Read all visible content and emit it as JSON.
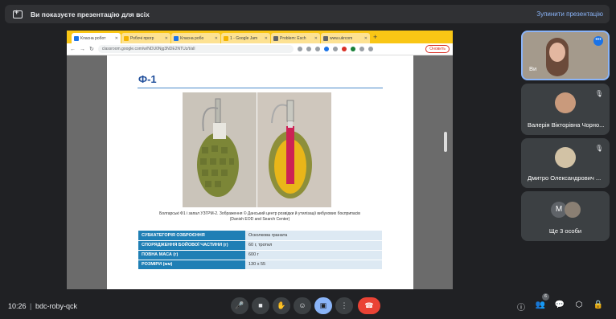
{
  "banner": {
    "text": "Ви показуєте презентацію для всіх",
    "stop_label": "Зупинити презентацію"
  },
  "browser": {
    "tabs": [
      {
        "label": "Класна робот"
      },
      {
        "label": "Робочі прогр"
      },
      {
        "label": "Класна робо"
      },
      {
        "label": "1 - Google Jam"
      },
      {
        "label": "Problem: Esch"
      },
      {
        "label": "www.ukrcom"
      }
    ],
    "new_tab": "+",
    "url": "classroom.google.com/w/NDU0Njg3NDE2NTUz/t/all",
    "reload_label": "Оновить"
  },
  "document": {
    "heading": "Ф-1",
    "caption_line1": "Болгарські Ф1 і запал УЗГРМ-2. Зображення © Данський центр розвідки й утилізації вибухових боєприпасів",
    "caption_line2": "(Danish EOD and Search Center)",
    "rows": [
      {
        "key": "СУБКАТЕГОРІЯ ОЗБРОЄННЯ",
        "value": "Осколкова граната"
      },
      {
        "key": "СПОРЯДЖЕННЯ БОЙОВОЇ ЧАСТИНИ (г)",
        "value": "60 г, тротил"
      },
      {
        "key": "ПОВНА МАСА (г)",
        "value": "600 г"
      },
      {
        "key": "РОЗМІРИ (мм)",
        "value": "130 х 55"
      }
    ]
  },
  "participants": {
    "self_name": "Ви",
    "p2_name": "Валерія Вікторівна Чорно...",
    "p3_name": "Дмитро Олександрович ...",
    "others_initial": "М",
    "others_label": "Ще 3 особи"
  },
  "bottom": {
    "time": "10:26",
    "separator": "|",
    "meeting_code": "bdc-roby-qck",
    "people_count": "6"
  }
}
